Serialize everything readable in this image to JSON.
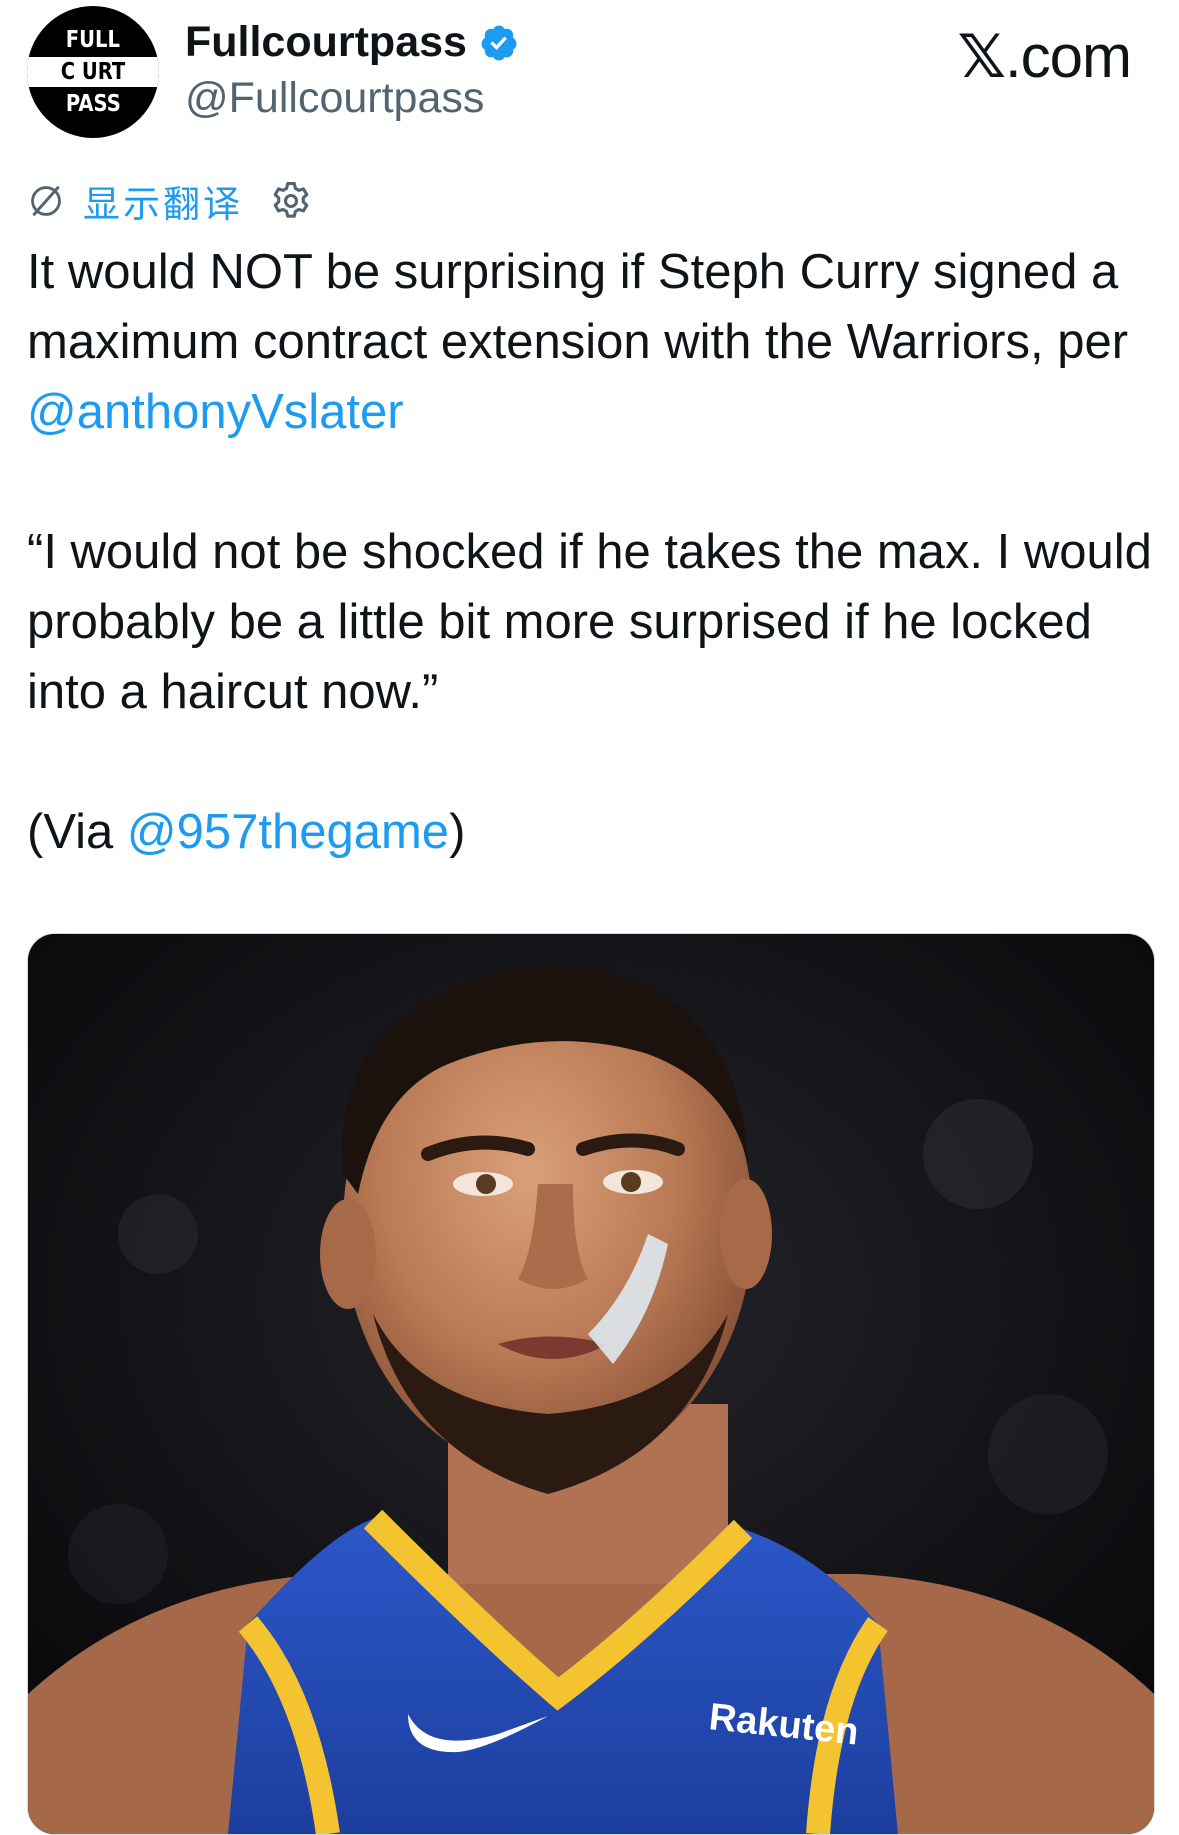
{
  "account": {
    "logo_lines": [
      "FULL",
      "C  URT",
      "PASS"
    ],
    "name": "Fullcourtpass",
    "handle": "@Fullcourtpass"
  },
  "brand": {
    "x": "𝕏",
    "text": ".com"
  },
  "translate": {
    "label": "显示翻译"
  },
  "tweet": {
    "line1": "It would NOT be surprising if Steph Curry signed a maximum contract extension with the Warriors, per ",
    "mention1": "@anthonyVslater",
    "quote": "“I would not be shocked if he takes the max. I would probably be a little bit more surprised if he locked into a haircut now.”",
    "via_prefix": "(Via ",
    "mention2": "@957thegame",
    "via_suffix": ")"
  },
  "jersey": {
    "sponsor": "Rakuten"
  },
  "colors": {
    "accent": "#1d9bf0",
    "text": "#0f1419",
    "secondary": "#536471"
  }
}
